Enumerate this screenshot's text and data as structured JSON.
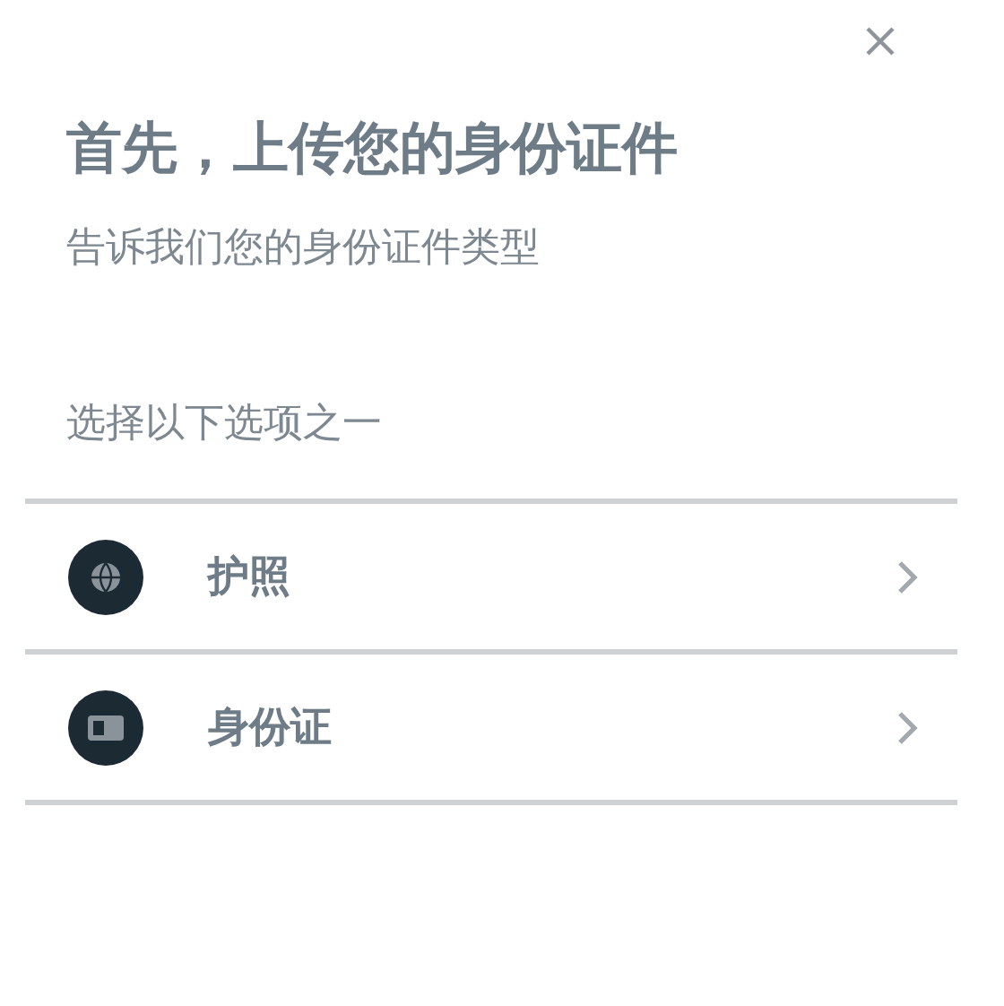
{
  "title": "首先，上传您的身份证件",
  "subtitle": "告诉我们您的身份证件类型",
  "prompt": "选择以下选项之一",
  "options": [
    {
      "kind": "passport",
      "label": "护照"
    },
    {
      "kind": "id-card",
      "label": "身份证"
    }
  ]
}
